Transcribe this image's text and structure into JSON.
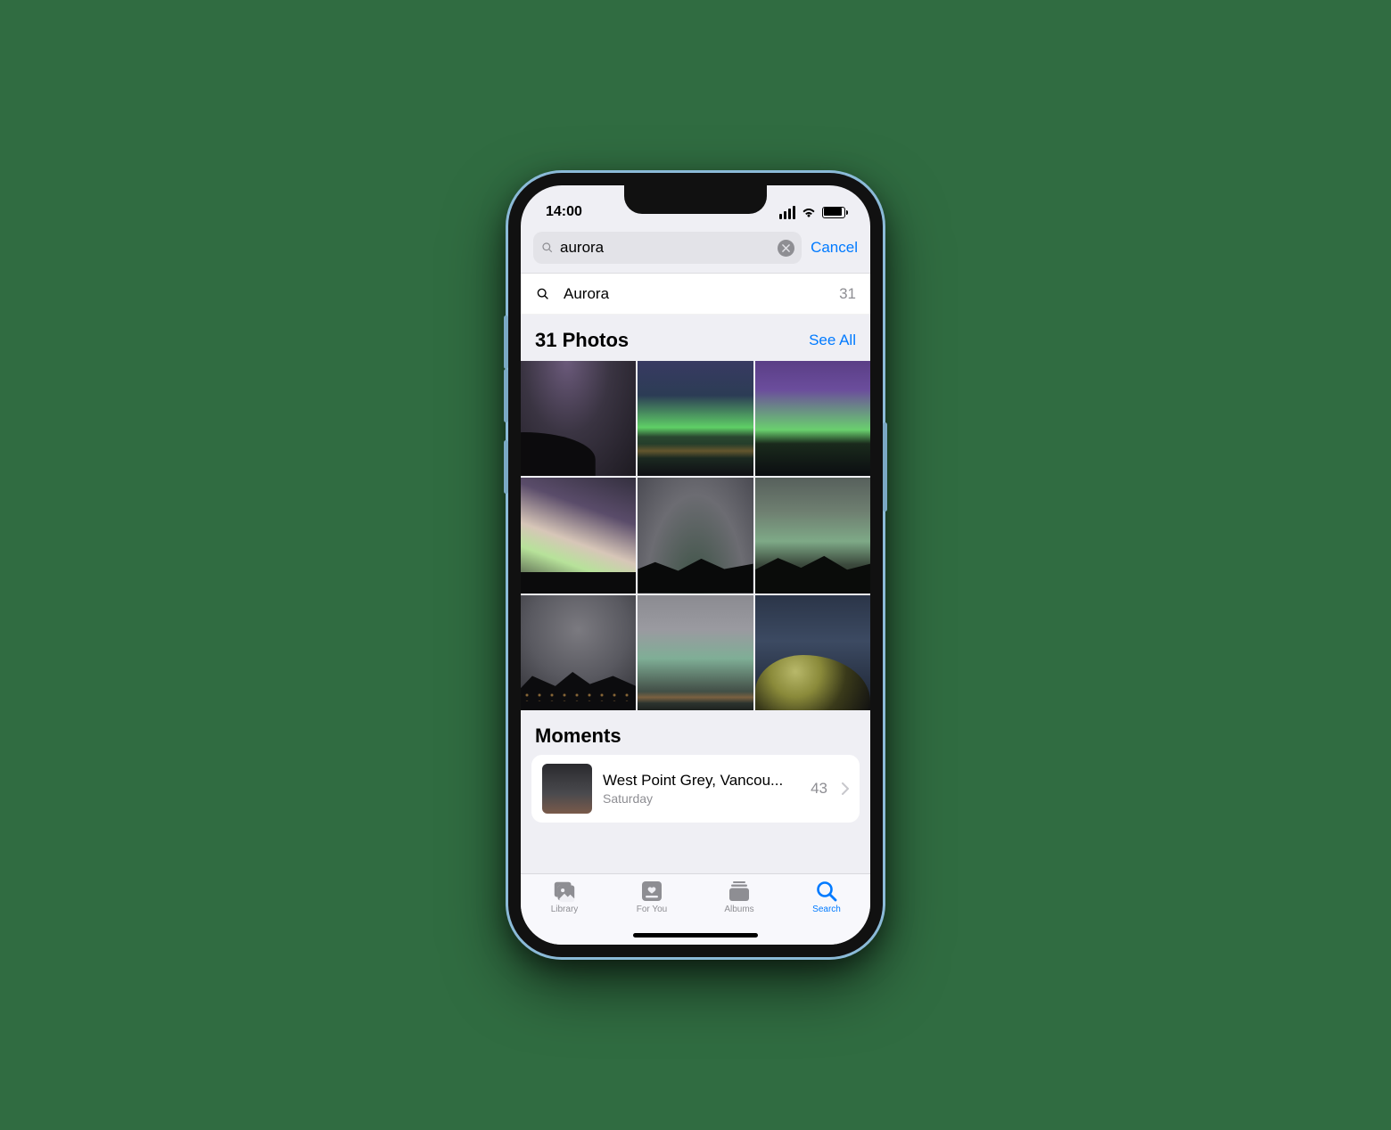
{
  "status": {
    "time": "14:00"
  },
  "search": {
    "value": "aurora",
    "cancel_label": "Cancel",
    "suggestion_label": "Aurora",
    "suggestion_count": "31"
  },
  "photos_section": {
    "heading": "31 Photos",
    "see_all_label": "See All"
  },
  "moments": {
    "heading": "Moments",
    "item": {
      "title": "West Point Grey, Vancou...",
      "subtitle": "Saturday",
      "count": "43"
    }
  },
  "tabs": {
    "library": "Library",
    "for_you": "For You",
    "albums": "Albums",
    "search": "Search"
  }
}
